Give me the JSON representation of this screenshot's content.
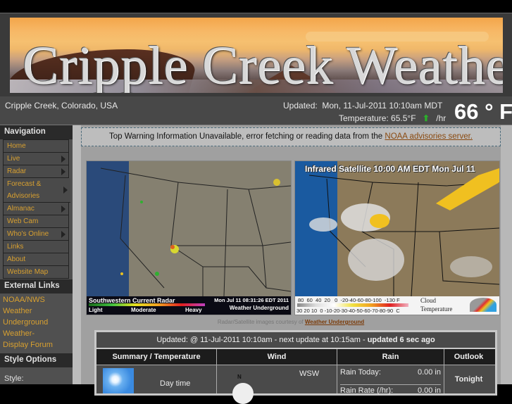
{
  "banner": {
    "title": "Cripple Creek Weather"
  },
  "infobar": {
    "location": "Cripple Creek, Colorado, USA",
    "updated_label": "Updated:",
    "updated_value": "Mon, 11-Jul-2011 10:10am MDT",
    "temperature_label": "Temperature:",
    "temperature_value": "65.5°F",
    "trend_icon": "up-arrow-icon",
    "trend_unit": "/hr",
    "big_temp": "66 ° F"
  },
  "sidebar": {
    "nav_heading": "Navigation",
    "nav_items": [
      {
        "label": "Home",
        "submenu": false
      },
      {
        "label": "Live",
        "submenu": true
      },
      {
        "label": "Radar",
        "submenu": true
      },
      {
        "label": "Forecast & Advisories",
        "submenu": true
      },
      {
        "label": "Almanac",
        "submenu": true
      },
      {
        "label": "Web Cam",
        "submenu": false
      },
      {
        "label": "Who's Online",
        "submenu": true
      },
      {
        "label": "Links",
        "submenu": false
      },
      {
        "label": "About",
        "submenu": false
      },
      {
        "label": "Website Map",
        "submenu": false
      }
    ],
    "external_heading": "External Links",
    "external_links": [
      "NOAA/NWS",
      "Weather Underground",
      "Weather-Display Forum"
    ],
    "style_heading": "Style Options",
    "style_label": "Style:"
  },
  "warning": {
    "text": "Top Warning Information Unavailable, error fetching or reading data from the ",
    "link": "NOAA advisories server."
  },
  "radar": {
    "caption_title": "Southwestern Current Radar",
    "caption_time": "Mon Jul 11 08:31:26 EDT 2011",
    "legend_light": "Light",
    "legend_moderate": "Moderate",
    "legend_heavy": "Heavy",
    "brand": "Weather Underground"
  },
  "satellite": {
    "title": "Infrared Satellite 10:00 AM EDT Mon Jul 11",
    "scale_f": "80  60  40  20   0  -20-40-60-80-100  -130 F",
    "scale_c": "30 20 10  0 -10-20-30-40-50-60-70-80-90  C",
    "legend_line1": "Cloud",
    "legend_line2": "Temperature"
  },
  "courtesy": {
    "text": "Radar/Satellite images courtesy of ",
    "link": "Weather Underground"
  },
  "conditions": {
    "updated_text": "Updated: @ 11-Jul-2011 10:10am - next update at 10:15am   - ",
    "updated_ago": "updated 6 sec ago",
    "headers": [
      "Summary / Temperature",
      "Wind",
      "Rain",
      "Outlook"
    ],
    "summary": "Day time",
    "wind_direction": "WSW",
    "compass_north": "N",
    "rain_today_label": "Rain Today:",
    "rain_today_value": "0.00 in",
    "rain_rate_label": "Rain Rate (/hr):",
    "rain_rate_value": "0.00 in",
    "outlook": "Tonight"
  }
}
